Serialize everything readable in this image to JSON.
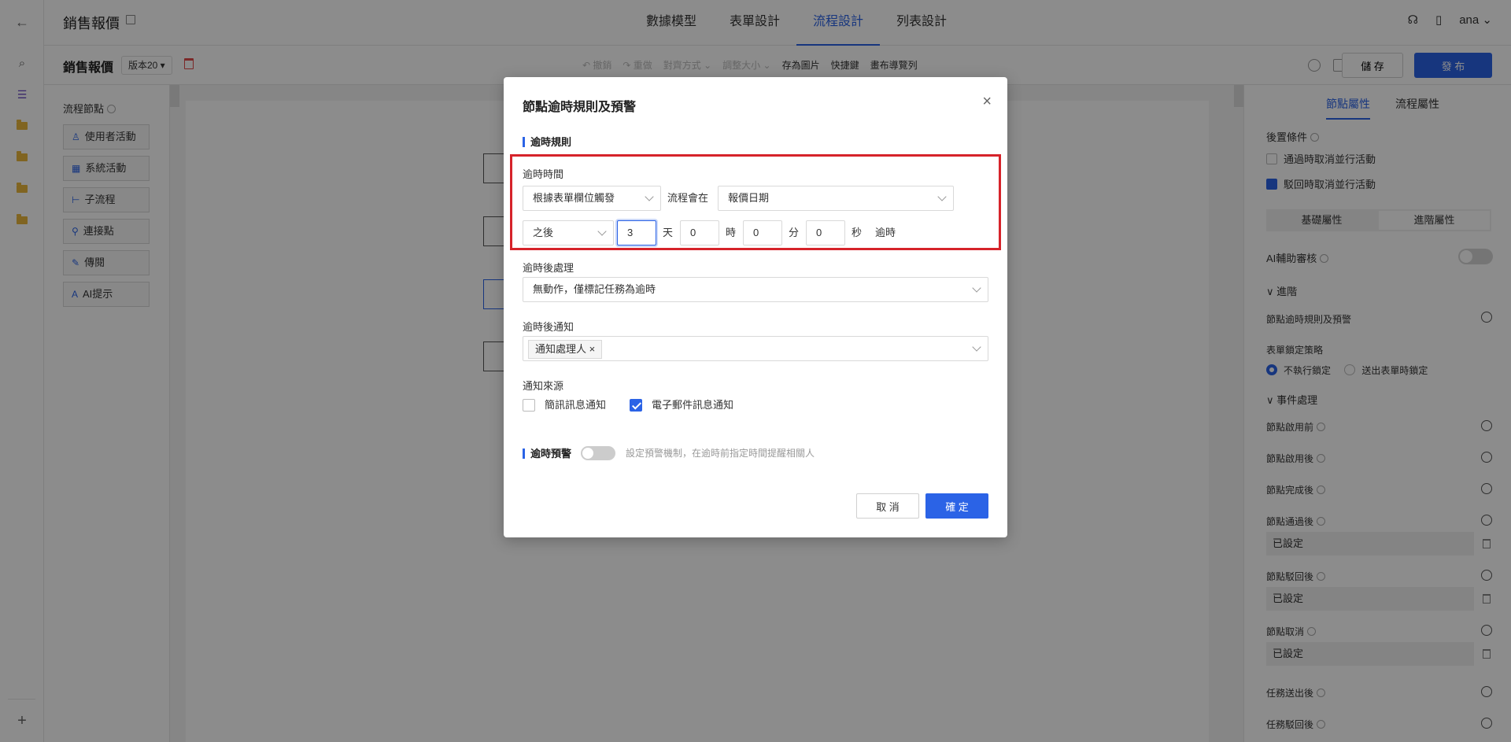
{
  "app": {
    "title": "銷售報價"
  },
  "nav_tabs": [
    {
      "label": "數據模型"
    },
    {
      "label": "表單設計"
    },
    {
      "label": "流程設計"
    },
    {
      "label": "列表設計"
    }
  ],
  "user": {
    "name": "ana"
  },
  "toolbar": {
    "doc_title": "銷售報價",
    "version": "版本20 ▾",
    "tools": [
      "↶ 撤銷",
      "↷ 重做",
      "對齊方式 ⌄",
      "調整大小 ⌄",
      "存為圖片",
      "快捷鍵",
      "畫布導覽列"
    ],
    "save_label": "儲 存",
    "publish_label": "發 布"
  },
  "palette": {
    "title": "流程節點",
    "items": [
      {
        "icon": "user-icon",
        "label": "使用者活動"
      },
      {
        "icon": "grid-icon",
        "label": "系統活動"
      },
      {
        "icon": "subflow-icon",
        "label": "子流程"
      },
      {
        "icon": "link-icon",
        "label": "連接點"
      },
      {
        "icon": "cc-icon",
        "label": "傳閱"
      },
      {
        "icon": "ai-icon",
        "label": "AI提示"
      }
    ]
  },
  "props": {
    "tabs": [
      "節點屬性",
      "流程屬性"
    ],
    "post_condition": "後置條件",
    "cb1": "通過時取消並行活動",
    "cb2": "駁回時取消並行活動",
    "seg": [
      "基礎屬性",
      "進階屬性"
    ],
    "ai_review": "AI輔助審核",
    "advanced": "∨ 進階",
    "timeout_rule": "節點逾時規則及預警",
    "lock_policy": "表單鎖定策略",
    "lock_opt1": "不執行鎖定",
    "lock_opt2": "送出表單時鎖定",
    "events": "∨ 事件處理",
    "ev1": "節點啟用前",
    "ev2": "節點啟用後",
    "ev3": "節點完成後",
    "ev4": "節點通過後",
    "ev5": "節點駁回後",
    "ev6": "節點取消",
    "ev7": "任務送出後",
    "ev8": "任務駁回後",
    "set": "已設定"
  },
  "modal": {
    "title": "節點逾時規則及預警",
    "close": "×",
    "section_rule": "逾時規則",
    "timeout_time_label": "逾時時間",
    "trigger_select": "根據表單欄位觸發",
    "flow_will": "流程會在",
    "date_field": "報價日期",
    "after_select": "之後",
    "days_value": "3",
    "days_unit": "天",
    "hours_value": "0",
    "hours_unit": "時",
    "minutes_value": "0",
    "minutes_unit": "分",
    "seconds_value": "0",
    "seconds_unit": "秒",
    "timeout_suffix": "逾時",
    "after_handling_label": "逾時後處理",
    "after_handling_value": "無動作，僅標記任務為逾時",
    "notify_label": "逾時後通知",
    "notify_tag": "通知處理人",
    "notify_source_label": "通知來源",
    "sms_label": "簡訊訊息通知",
    "email_label": "電子郵件訊息通知",
    "warning_section": "逾時預警",
    "warning_hint": "設定預警機制，在逾時前指定時間提醒相關人",
    "cancel": "取 消",
    "ok": "確 定"
  },
  "colors": {
    "accent": "#2b63e6",
    "highlight": "#d6232a"
  }
}
